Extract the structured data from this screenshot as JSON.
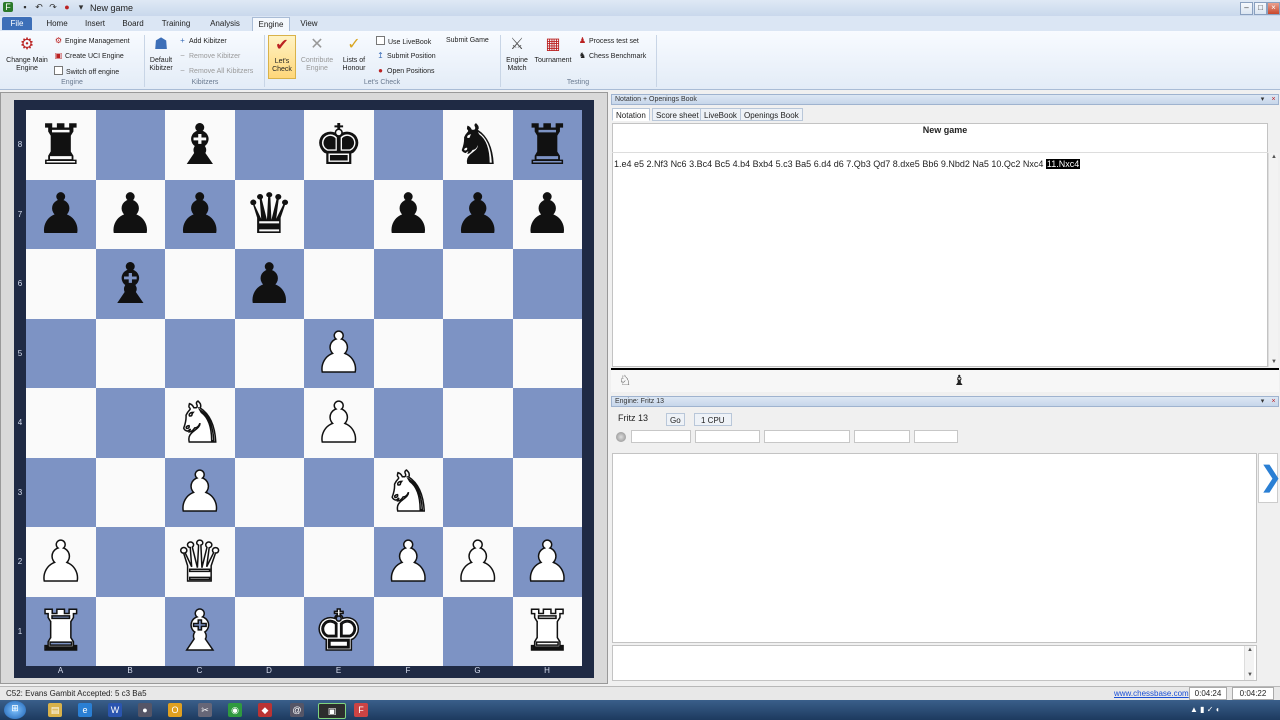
{
  "window": {
    "title": "New game",
    "app_icon": "fritz-icon"
  },
  "ribbon_tabs": [
    {
      "label": "File"
    },
    {
      "label": "Home"
    },
    {
      "label": "Insert"
    },
    {
      "label": "Board"
    },
    {
      "label": "Training"
    },
    {
      "label": "Analysis"
    },
    {
      "label": "Engine"
    },
    {
      "label": "View"
    }
  ],
  "ribbon": {
    "engine_group": {
      "label": "Engine",
      "change_main_engine": "Change Main Engine",
      "engine_management": "Engine Management",
      "create_uci_engine": "Create UCI Engine",
      "switch_off_engine": "Switch off engine"
    },
    "kibitzers_group": {
      "label": "Kibitzers",
      "default_kibitzer": "Default Kibitzer",
      "add_kibitzer": "Add Kibitzer",
      "remove_kibitzer": "Remove Kibitzer",
      "remove_all_kibitzers": "Remove All Kibitzers"
    },
    "letscheck_group": {
      "label": "Let's Check",
      "lets_check": "Let's Check",
      "contribute_engine": "Contribute Engine",
      "lists_of_honour": "Lists of Honour",
      "use_livebook": "Use LiveBook",
      "submit_position": "Submit Position",
      "open_positions": "Open Positions",
      "submit_game": "Submit Game"
    },
    "testing_group": {
      "label": "Testing",
      "engine_match": "Engine Match",
      "tournament": "Tournament",
      "process_test_set": "Process test set",
      "chess_benchmark": "Chess Benchmark"
    }
  },
  "board": {
    "ranks": [
      "8",
      "7",
      "6",
      "5",
      "4",
      "3",
      "2",
      "1"
    ],
    "files": [
      "A",
      "B",
      "C",
      "D",
      "E",
      "F",
      "G",
      "H"
    ],
    "position": [
      [
        "bR",
        "",
        "bB",
        "",
        "bK",
        "",
        "bN",
        "bR"
      ],
      [
        "bP",
        "bP",
        "bP",
        "bQ",
        "",
        "bP",
        "bP",
        "bP"
      ],
      [
        "",
        "bB",
        "",
        "bP",
        "",
        "",
        "",
        ""
      ],
      [
        "",
        "",
        "",
        "",
        "wP",
        "",
        "",
        ""
      ],
      [
        "",
        "",
        "wN",
        "",
        "wP",
        "",
        "",
        ""
      ],
      [
        "",
        "",
        "wP",
        "",
        "",
        "wN",
        "",
        ""
      ],
      [
        "wP",
        "",
        "wQ",
        "",
        "",
        "wP",
        "wP",
        "wP"
      ],
      [
        "wR",
        "",
        "wB",
        "",
        "wK",
        "",
        "",
        "wR"
      ]
    ]
  },
  "notation_panel": {
    "title": "Notation + Openings Book",
    "tabs": [
      "Notation",
      "Score sheet",
      "LiveBook",
      "Openings Book"
    ],
    "game_title": "New game",
    "moves": [
      "1.e4",
      "e5",
      "2.Nf3",
      "Nc6",
      "3.Bc4",
      "Bc5",
      "4.b4",
      "Bxb4",
      "5.c3",
      "Ba5",
      "6.d4",
      "d6",
      "7.Qb3",
      "Qd7",
      "8.dxe5",
      "Bb6",
      "9.Nbd2",
      "Na5",
      "10.Qc2",
      "Nxc4"
    ],
    "current_move": "11.Nxc4"
  },
  "engine_panel": {
    "title": "Engine: Fritz 13",
    "engine_name": "Fritz 13",
    "go_label": "Go",
    "cpu_label": "1 CPU"
  },
  "status": {
    "opening": "C52: Evans Gambit Accepted: 5 c3 Ba5",
    "link": "www.chessbase.com",
    "clock_white": "0:04:24",
    "clock_black": "0:04:22"
  },
  "taskbar": {
    "icons": [
      "start-orb-icon",
      "explorer-icon",
      "ie-icon",
      "word-icon",
      "media-icon",
      "notes-icon",
      "tools-icon",
      "chrome-icon",
      "app-icon",
      "tool2-icon",
      "nvidia-icon",
      "fritz-task-icon"
    ],
    "tray_time": ""
  },
  "colors": {
    "board_dark": "#7d93c4",
    "board_light": "#fafafa",
    "board_frame": "#1f2a44"
  }
}
